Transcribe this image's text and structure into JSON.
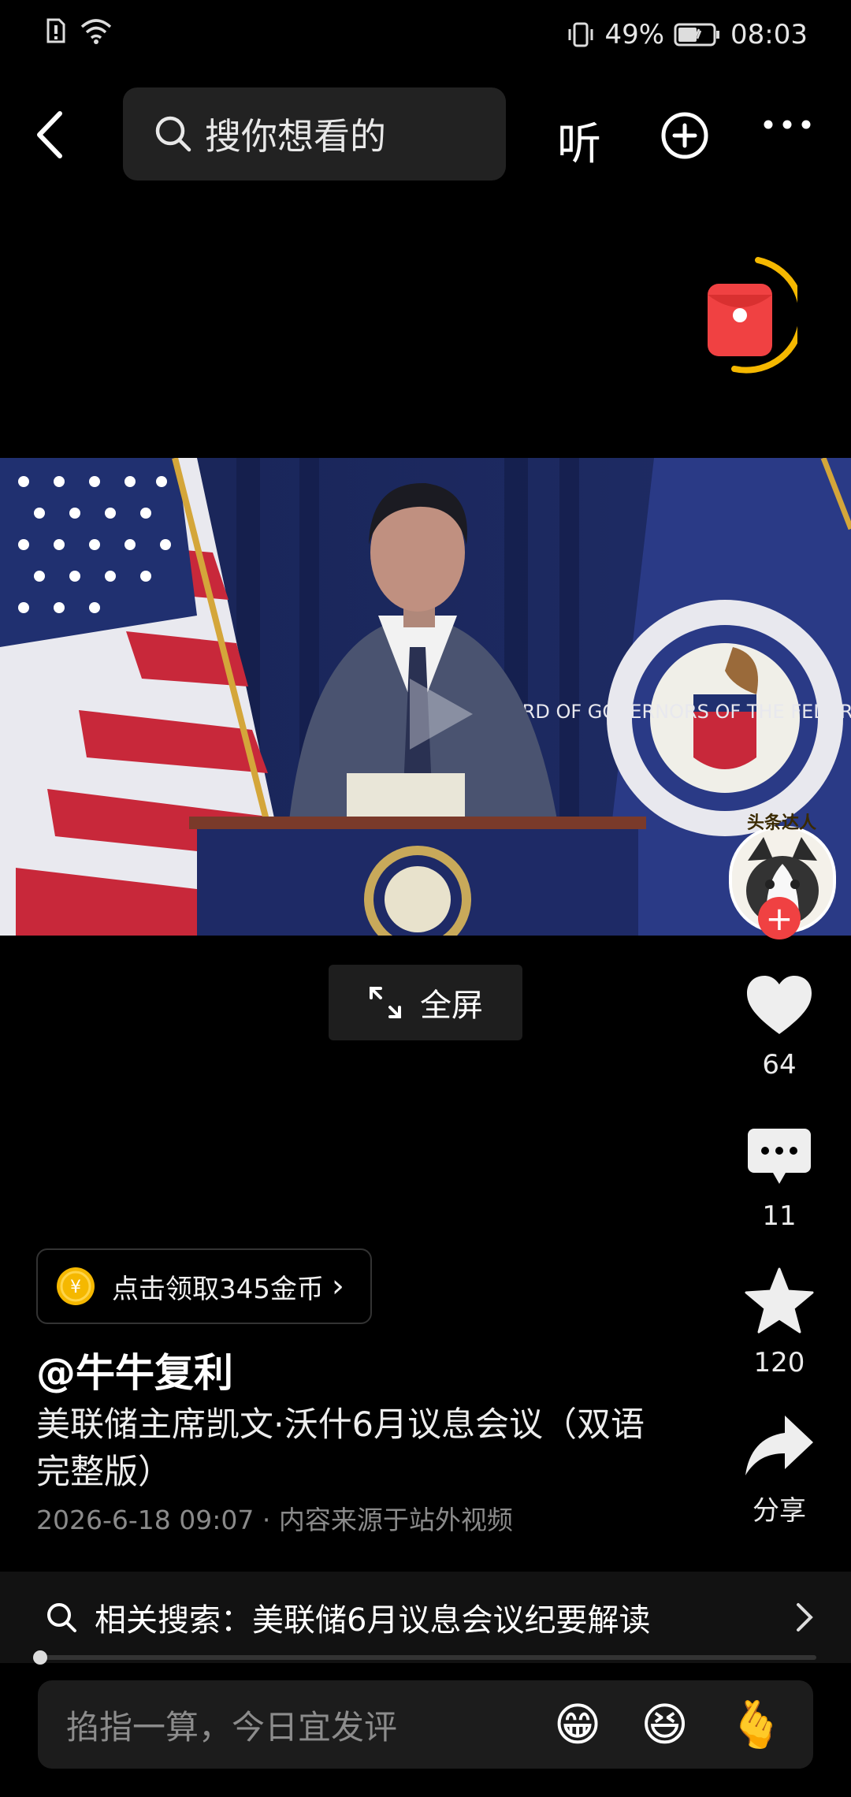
{
  "status_bar": {
    "battery": "49%",
    "time": "08:03"
  },
  "nav": {
    "search_placeholder": "搜你想看的",
    "listen_label": "听"
  },
  "actions": {
    "likes": "64",
    "comments": "11",
    "favorites": "120",
    "share_label": "分享"
  },
  "fullscreen_label": "全屏",
  "coins": {
    "label": "点击领取345金币",
    "chevron": "›"
  },
  "post": {
    "author": "@牛牛复利",
    "title": "美联储主席凯文·沃什6月议息会议（双语完整版）",
    "meta": "2026-6-18 09:07 · 内容来源于站外视频"
  },
  "video": {
    "seal_text": "BOARD OF GOVERNORS OF THE FEDERAL RESERVE",
    "avatar_badge": "头条达人"
  },
  "related_search": {
    "label": "相关搜索：美联储6月议息会议纪要解读"
  },
  "playback_progress": 0.0,
  "comment_bar": {
    "placeholder": "掐指一算，今日宜发评",
    "emojis": [
      "😁",
      "😆",
      "🫰"
    ]
  },
  "colors": {
    "accent_red": "#f04142",
    "ring_yellow": "#f5b800"
  }
}
